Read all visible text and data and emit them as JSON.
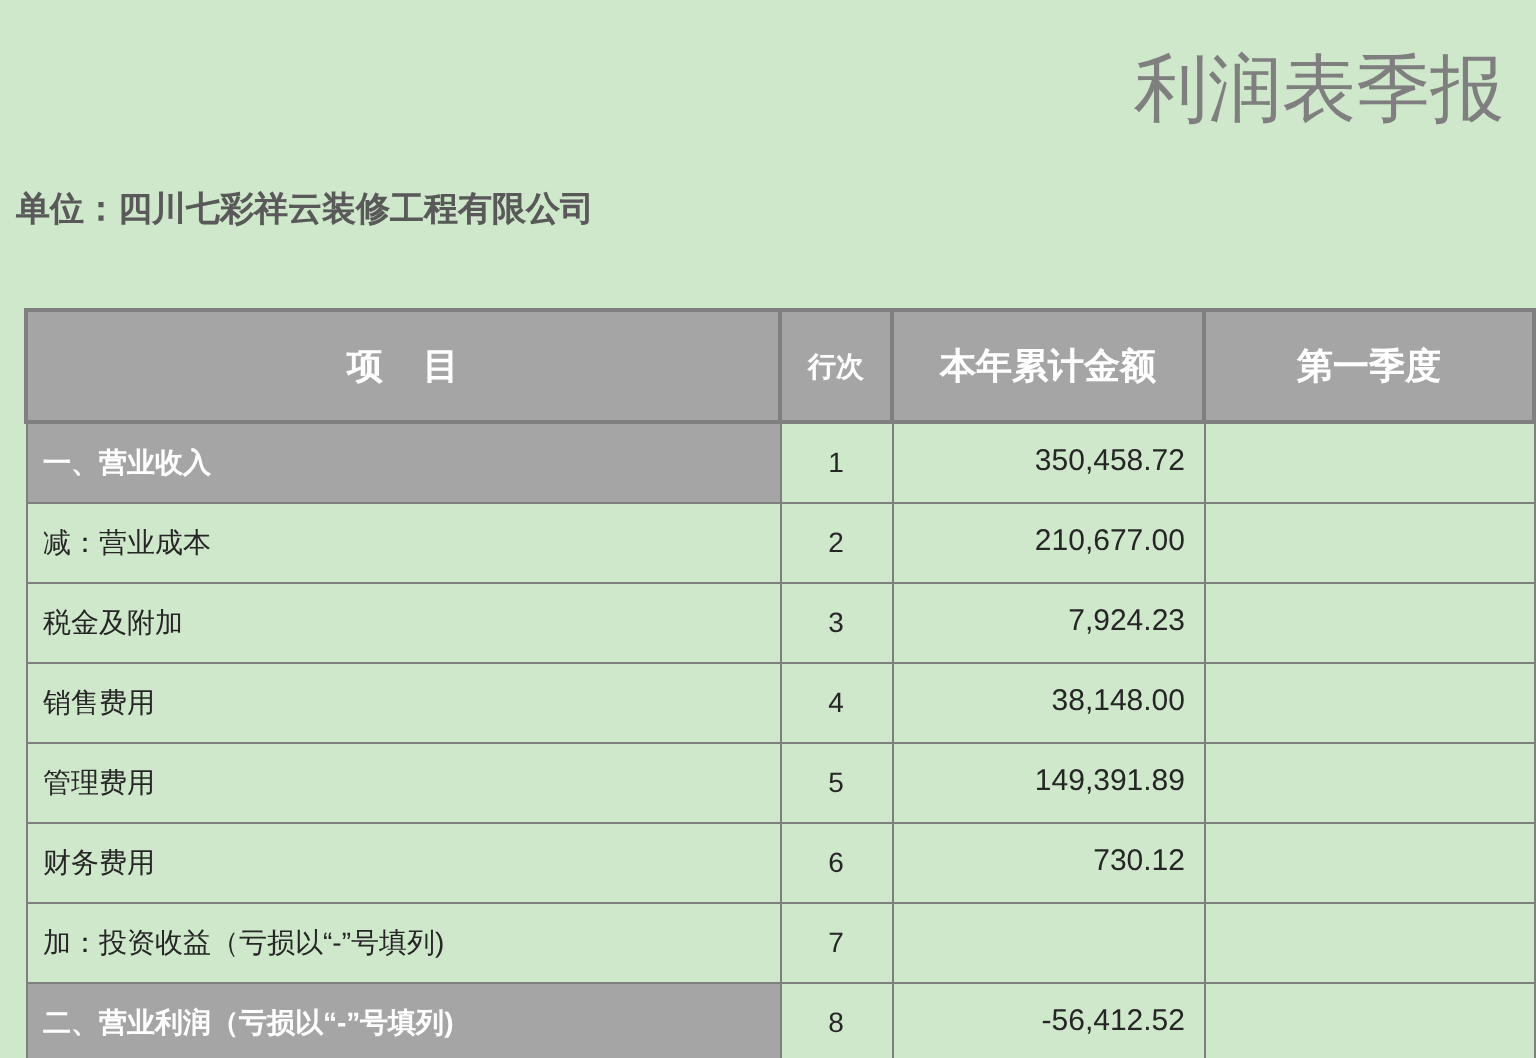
{
  "title": "利润表季报",
  "unit": "单位：四川七彩祥云装修工程有限公司",
  "table": {
    "columns": [
      "项    目",
      "行次",
      "本年累计金额",
      "第一季度"
    ],
    "rows": [
      {
        "item": "一、营业收入",
        "line": "1",
        "amount": "350,458.72",
        "highlighted": true
      },
      {
        "item": "减：营业成本",
        "line": "2",
        "amount": "210,677.00",
        "highlighted": false
      },
      {
        "item": "税金及附加",
        "line": "3",
        "amount": "7,924.23",
        "highlighted": false
      },
      {
        "item": "销售费用",
        "line": "4",
        "amount": "38,148.00",
        "highlighted": false
      },
      {
        "item": "管理费用",
        "line": "5",
        "amount": "149,391.89",
        "highlighted": false
      },
      {
        "item": "财务费用",
        "line": "6",
        "amount": "730.12",
        "highlighted": false
      },
      {
        "item": "加：投资收益（亏损以“-”号填列)",
        "line": "7",
        "highlighted": false
      },
      {
        "item": "二、营业利润（亏损以“-”号填列)",
        "line": "8",
        "amount": "-56,412.52",
        "highlighted": true
      }
    ]
  }
}
